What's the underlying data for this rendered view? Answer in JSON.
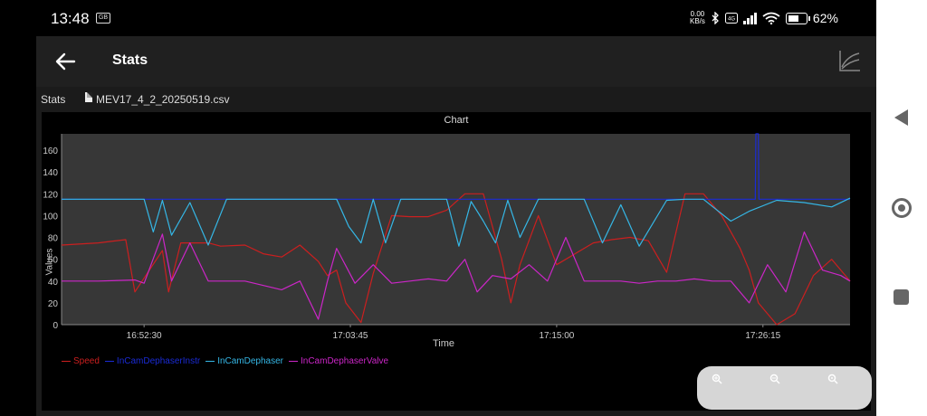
{
  "status_bar": {
    "time": "13:48",
    "notification_icon": "gb-icon",
    "net_speed_value": "0.00",
    "net_speed_unit": "KB/s",
    "battery": "62%",
    "battery_level_percent": 62
  },
  "toolbar": {
    "title": "Stats",
    "back_icon": "arrow-left-icon",
    "chart_icon": "line-chart-icon"
  },
  "breadcrumb": {
    "root": "Stats",
    "file": "MEV17_4_2_20250519.csv"
  },
  "chart_data": {
    "type": "line",
    "title": "Chart",
    "xlabel": "Time",
    "ylabel": "Values",
    "ylim": [
      0,
      175
    ],
    "yticks": [
      0,
      20,
      40,
      60,
      80,
      100,
      120,
      140,
      160
    ],
    "xlim": [
      "16:48:00",
      "17:31:00"
    ],
    "xticks": [
      "16:52:30",
      "17:03:45",
      "17:15:00",
      "17:26:15"
    ],
    "grid": false,
    "legend": "bottom-left",
    "background": "#373737",
    "series": [
      {
        "name": "Speed",
        "color": "#cc1f1f",
        "x": [
          "16:48:00",
          "16:50:00",
          "16:51:30",
          "16:52:00",
          "16:53:30",
          "16:53:50",
          "16:54:30",
          "16:55:10",
          "16:56:00",
          "16:56:40",
          "16:58:00",
          "16:59:00",
          "17:00:00",
          "17:01:00",
          "17:02:00",
          "17:02:30",
          "17:03:00",
          "17:03:30",
          "17:04:20",
          "17:05:00",
          "17:06:00",
          "17:07:00",
          "17:08:00",
          "17:09:00",
          "17:10:00",
          "17:10:30",
          "17:11:00",
          "17:12:00",
          "17:12:30",
          "17:13:00",
          "17:14:00",
          "17:15:00",
          "17:16:00",
          "17:17:00",
          "17:18:00",
          "17:19:00",
          "17:20:00",
          "17:21:00",
          "17:22:00",
          "17:23:00",
          "17:24:00",
          "17:25:00",
          "17:25:30",
          "17:26:00",
          "17:27:00",
          "17:28:00",
          "17:29:00",
          "17:30:00",
          "17:31:00"
        ],
        "y": [
          73,
          75,
          78,
          30,
          68,
          30,
          75,
          75,
          75,
          72,
          73,
          65,
          62,
          73,
          58,
          45,
          50,
          20,
          2,
          47,
          100,
          99,
          99,
          105,
          120,
          120,
          120,
          60,
          20,
          55,
          100,
          55,
          65,
          75,
          78,
          80,
          77,
          48,
          120,
          120,
          100,
          70,
          50,
          20,
          0,
          10,
          45,
          60,
          40
        ]
      },
      {
        "name": "InCamDephaserInstr",
        "color": "#1a2bd6",
        "x": [
          "16:48:00",
          "17:25:50",
          "17:25:52",
          "17:26:00",
          "17:26:02",
          "17:31:00"
        ],
        "y": [
          115,
          115,
          175,
          175,
          115,
          115
        ]
      },
      {
        "name": "InCamDephaser",
        "color": "#35b7e6",
        "x": [
          "16:48:00",
          "16:52:30",
          "16:53:00",
          "16:53:30",
          "16:54:00",
          "16:55:00",
          "16:56:00",
          "16:57:00",
          "17:00:00",
          "17:03:00",
          "17:03:40",
          "17:04:20",
          "17:05:00",
          "17:05:40",
          "17:06:30",
          "17:07:30",
          "17:09:00",
          "17:09:40",
          "17:10:20",
          "17:11:00",
          "17:11:40",
          "17:12:20",
          "17:13:00",
          "17:14:00",
          "17:15:30",
          "17:16:30",
          "17:17:30",
          "17:18:30",
          "17:19:30",
          "17:21:00",
          "17:22:00",
          "17:23:00",
          "17:24:30",
          "17:25:30",
          "17:27:00",
          "17:28:30",
          "17:30:00",
          "17:31:00"
        ],
        "y": [
          115,
          115,
          85,
          114,
          82,
          112,
          73,
          115,
          115,
          115,
          90,
          75,
          115,
          75,
          115,
          115,
          115,
          72,
          113,
          95,
          75,
          114,
          80,
          115,
          115,
          115,
          75,
          110,
          72,
          114,
          115,
          115,
          95,
          104,
          114,
          112,
          108,
          116
        ]
      },
      {
        "name": "InCamDephaserValve",
        "color": "#cc26c8",
        "x": [
          "16:48:00",
          "16:50:00",
          "16:52:00",
          "16:52:30",
          "16:53:30",
          "16:54:00",
          "16:55:00",
          "16:56:00",
          "16:58:00",
          "17:00:00",
          "17:01:00",
          "17:02:00",
          "17:02:30",
          "17:03:00",
          "17:04:00",
          "17:05:00",
          "17:06:00",
          "17:07:00",
          "17:08:00",
          "17:09:00",
          "17:10:00",
          "17:10:40",
          "17:11:30",
          "17:12:30",
          "17:13:30",
          "17:14:30",
          "17:15:30",
          "17:16:30",
          "17:17:30",
          "17:18:30",
          "17:19:30",
          "17:20:30",
          "17:21:30",
          "17:22:30",
          "17:23:30",
          "17:24:30",
          "17:25:30",
          "17:26:30",
          "17:27:30",
          "17:28:30",
          "17:29:30",
          "17:30:30",
          "17:31:00"
        ],
        "y": [
          40,
          40,
          41,
          38,
          83,
          40,
          75,
          40,
          40,
          32,
          40,
          5,
          40,
          70,
          38,
          55,
          38,
          40,
          42,
          40,
          60,
          30,
          45,
          42,
          55,
          40,
          80,
          40,
          40,
          40,
          38,
          40,
          40,
          42,
          40,
          40,
          20,
          55,
          30,
          85,
          50,
          45,
          40
        ]
      }
    ]
  },
  "zoom_controls": {
    "zoom_in_icon": "zoom-in-icon",
    "zoom_out_icon": "zoom-out-icon",
    "zoom_reset_icon": "zoom-reset-icon"
  },
  "nav_bar": {
    "back_icon": "triangle-back-icon",
    "home_icon": "circle-home-icon",
    "recent_icon": "square-recent-icon"
  }
}
